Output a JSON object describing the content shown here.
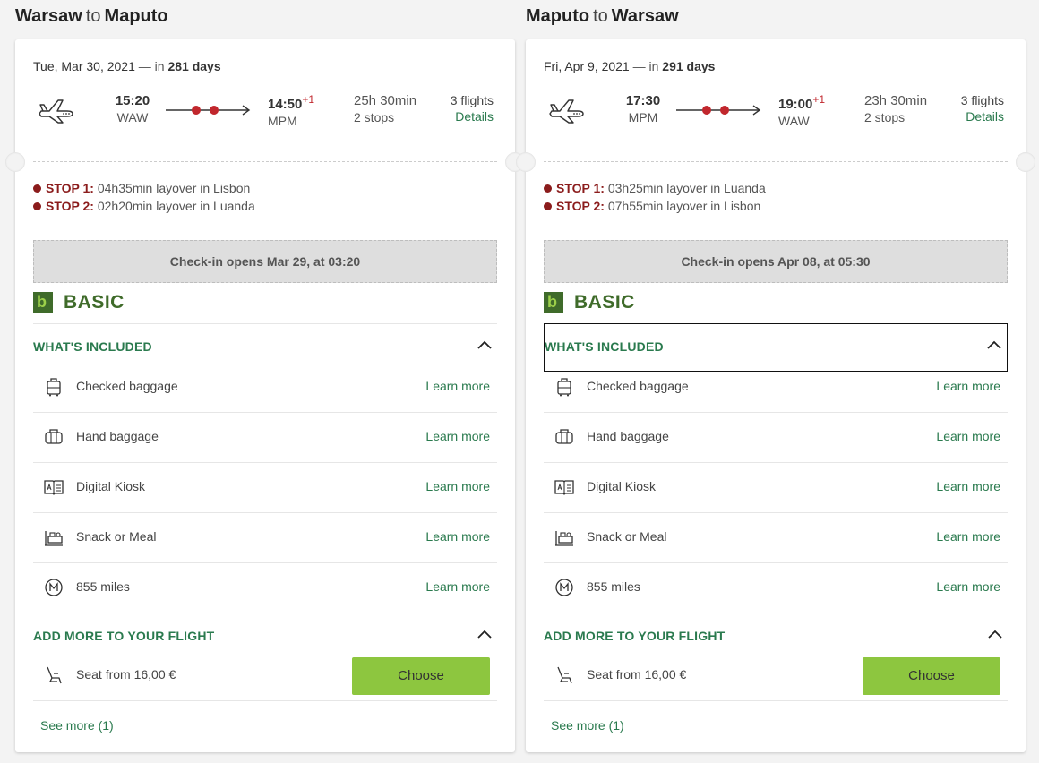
{
  "trips": [
    {
      "from": "Warsaw",
      "connector": "to",
      "to": "Maputo",
      "date": "Tue, Mar 30, 2021",
      "date_sep": "— in",
      "days": "281 days",
      "dep_time": "15:20",
      "dep_code": "WAW",
      "arr_time": "14:50",
      "arr_plus": "+1",
      "arr_code": "MPM",
      "duration": "25h 30min",
      "stops_count": "2 stops",
      "flights": "3 flights",
      "details": "Details",
      "stops": [
        {
          "label": "STOP 1:",
          "text": "04h35min layover in Lisbon"
        },
        {
          "label": "STOP 2:",
          "text": "02h20min layover in Luanda"
        }
      ],
      "checkin": "Check-in opens Mar 29, at 03:20",
      "fare_logo": "b",
      "fare": "BASIC",
      "included_title": "WHAT'S INCLUDED",
      "items": [
        {
          "label": "Checked baggage",
          "more": "Learn more"
        },
        {
          "label": "Hand baggage",
          "more": "Learn more"
        },
        {
          "label": "Digital Kiosk",
          "more": "Learn more"
        },
        {
          "label": "Snack or Meal",
          "more": "Learn more"
        },
        {
          "label": "855 miles",
          "more": "Learn more"
        }
      ],
      "addmore_title": "ADD MORE TO YOUR FLIGHT",
      "seat": "Seat from 16,00 €",
      "choose": "Choose",
      "see_more": "See more (1)"
    },
    {
      "from": "Maputo",
      "connector": "to",
      "to": "Warsaw",
      "date": "Fri, Apr 9, 2021",
      "date_sep": "— in",
      "days": "291 days",
      "dep_time": "17:30",
      "dep_code": "MPM",
      "arr_time": "19:00",
      "arr_plus": "+1",
      "arr_code": "WAW",
      "duration": "23h 30min",
      "stops_count": "2 stops",
      "flights": "3 flights",
      "details": "Details",
      "stops": [
        {
          "label": "STOP 1:",
          "text": "03h25min layover in Luanda"
        },
        {
          "label": "STOP 2:",
          "text": "07h55min layover in Lisbon"
        }
      ],
      "checkin": "Check-in opens Apr 08, at 05:30",
      "fare_logo": "b",
      "fare": "BASIC",
      "included_title": "WHAT'S INCLUDED",
      "items": [
        {
          "label": "Checked baggage",
          "more": "Learn more"
        },
        {
          "label": "Hand baggage",
          "more": "Learn more"
        },
        {
          "label": "Digital Kiosk",
          "more": "Learn more"
        },
        {
          "label": "Snack or Meal",
          "more": "Learn more"
        },
        {
          "label": "855 miles",
          "more": "Learn more"
        }
      ],
      "addmore_title": "ADD MORE TO YOUR FLIGHT",
      "seat": "Seat from 16,00 €",
      "choose": "Choose",
      "see_more": "See more (1)"
    }
  ],
  "colors": {
    "accent_green": "#2a7a4e",
    "button_green": "#8dc63f",
    "stop_red": "#8b1c1c",
    "fare_green": "#3f6b2a"
  }
}
